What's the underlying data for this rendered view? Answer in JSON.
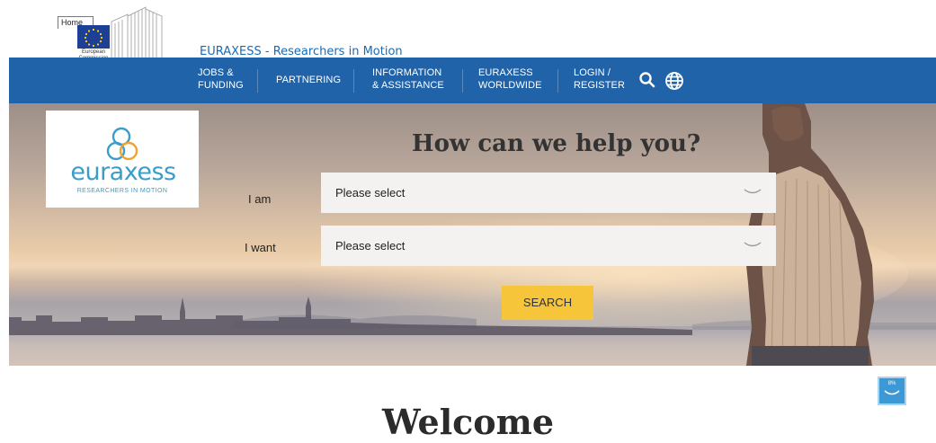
{
  "header": {
    "home_tab": "Home",
    "ec_label": "European Commission",
    "tagline": "EURAXESS - Researchers in Motion"
  },
  "nav": {
    "items": [
      {
        "line1": "JOBS &",
        "line2": "FUNDING"
      },
      {
        "line1": "PARTNERING",
        "line2": ""
      },
      {
        "line1": "INFORMATION",
        "line2": "& ASSISTANCE"
      },
      {
        "line1": "EURAXESS",
        "line2": "WORLDWIDE"
      },
      {
        "line1": "LOGIN /",
        "line2": "REGISTER"
      }
    ],
    "icons": [
      "search-icon",
      "globe-icon"
    ]
  },
  "hero": {
    "logo_word": "euraxess",
    "logo_tagline": "RESEARCHERS IN MOTION",
    "title": "How can we help you?",
    "form": {
      "i_am_label": "I am",
      "i_am_value": "Please select",
      "i_want_label": "I want",
      "i_want_value": "Please select",
      "search_label": "SEARCH"
    }
  },
  "scroll_indicator": {
    "percent": "8%"
  },
  "welcome": "Welcome",
  "colors": {
    "nav_blue": "#2163a9",
    "brand_light_blue": "#3b9dc8",
    "search_yellow": "#f6c53a",
    "logo_orange": "#f0a330"
  }
}
